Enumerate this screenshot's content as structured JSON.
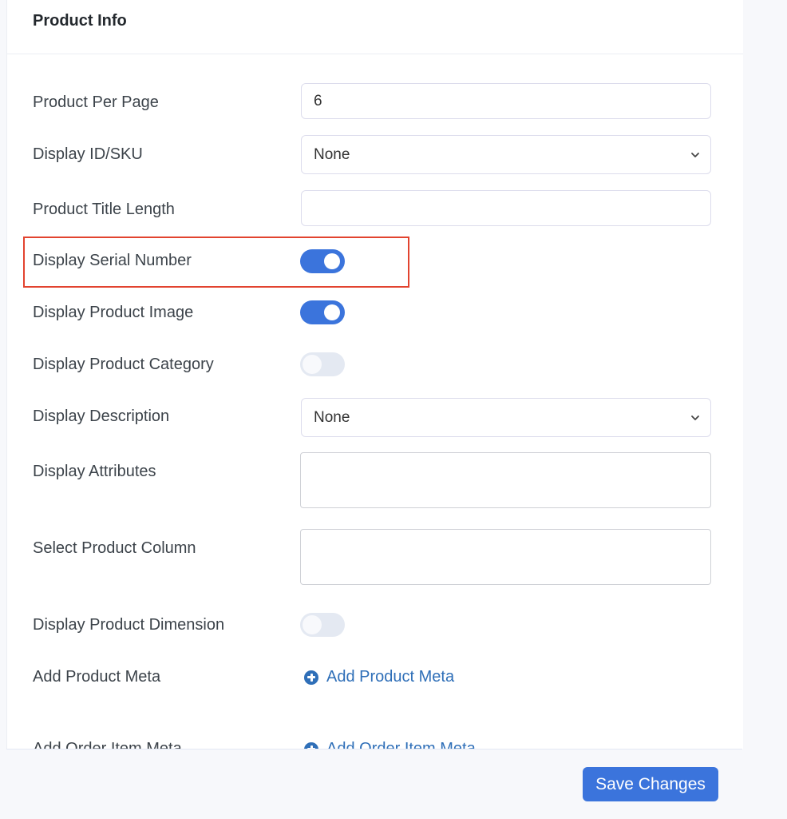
{
  "panel": {
    "title": "Product Info"
  },
  "fields": {
    "per_page": {
      "label": "Product Per Page",
      "value": "6"
    },
    "id_sku": {
      "label": "Display ID/SKU",
      "value": "None"
    },
    "title_length": {
      "label": "Product Title Length",
      "value": ""
    },
    "serial_number": {
      "label": "Display Serial Number",
      "enabled": true
    },
    "product_image": {
      "label": "Display Product Image",
      "enabled": true
    },
    "product_category": {
      "label": "Display Product Category",
      "enabled": false
    },
    "description": {
      "label": "Display Description",
      "value": "None"
    },
    "attributes": {
      "label": "Display Attributes",
      "value": ""
    },
    "product_column": {
      "label": "Select Product Column",
      "value": ""
    },
    "product_dimension": {
      "label": "Display Product Dimension",
      "enabled": false
    },
    "product_meta": {
      "label": "Add Product Meta",
      "link": "Add Product Meta"
    },
    "order_item_meta": {
      "label": "Add Order Item Meta",
      "link": "Add Order Item Meta"
    }
  },
  "footer": {
    "save_label": "Save Changes"
  },
  "colors": {
    "accent": "#3b74dc",
    "link": "#2f6fb8",
    "highlight": "#e2432f"
  }
}
